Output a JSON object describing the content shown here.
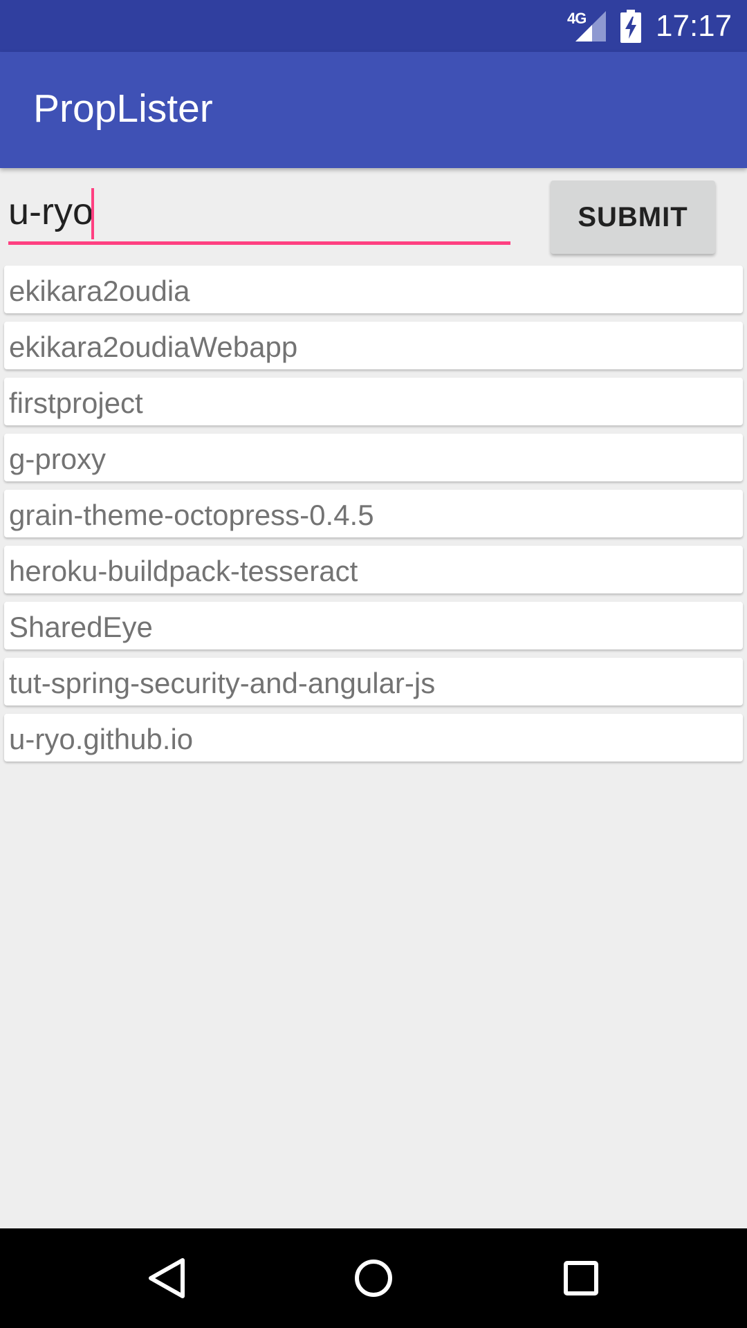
{
  "status_bar": {
    "network": "4G",
    "time": "17:17"
  },
  "app_bar": {
    "title": "PropLister"
  },
  "search": {
    "value": "u-ryo"
  },
  "submit": {
    "label": "SUBMIT"
  },
  "repos": [
    "ekikara2oudia",
    "ekikara2oudiaWebapp",
    "firstproject",
    "g-proxy",
    "grain-theme-octopress-0.4.5",
    "heroku-buildpack-tesseract",
    "SharedEye",
    "tut-spring-security-and-angular-js",
    "u-ryo.github.io"
  ],
  "nav_bar": {
    "icons": [
      "back-icon",
      "home-icon",
      "recents-icon"
    ]
  },
  "colors": {
    "status_bar": "#303f9f",
    "app_bar": "#3f51b5",
    "accent": "#ff4081",
    "background": "#eeeeee"
  }
}
